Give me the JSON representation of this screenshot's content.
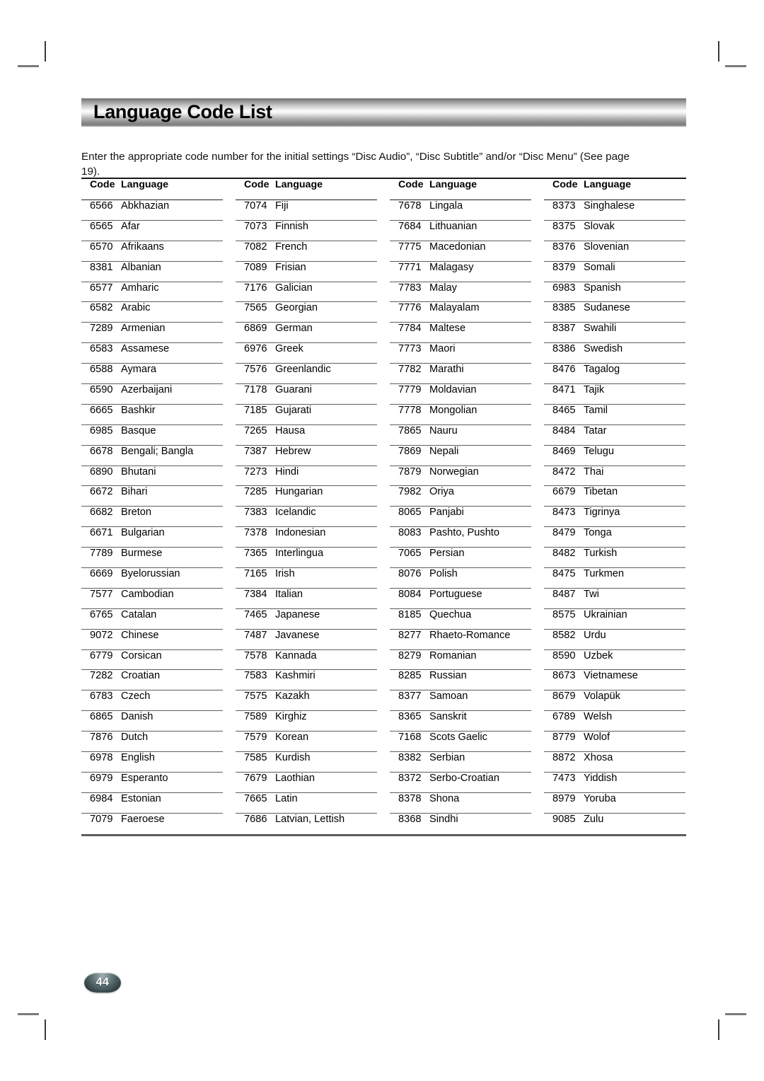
{
  "header": {
    "title": "Language Code List"
  },
  "intro": {
    "text": "Enter the appropriate code number for the initial settings “Disc Audio”, “Disc Subtitle” and/or “Disc Menu” (See page 19)."
  },
  "table": {
    "headers": {
      "code": "Code",
      "language": "Language"
    },
    "columns": [
      {
        "rows": [
          {
            "code": "6566",
            "language": "Abkhazian"
          },
          {
            "code": "6565",
            "language": "Afar"
          },
          {
            "code": "6570",
            "language": "Afrikaans"
          },
          {
            "code": "8381",
            "language": "Albanian"
          },
          {
            "code": "6577",
            "language": "Amharic"
          },
          {
            "code": "6582",
            "language": "Arabic"
          },
          {
            "code": "7289",
            "language": "Armenian"
          },
          {
            "code": "6583",
            "language": "Assamese"
          },
          {
            "code": "6588",
            "language": "Aymara"
          },
          {
            "code": "6590",
            "language": "Azerbaijani"
          },
          {
            "code": "6665",
            "language": "Bashkir"
          },
          {
            "code": "6985",
            "language": "Basque"
          },
          {
            "code": "6678",
            "language": "Bengali; Bangla"
          },
          {
            "code": "6890",
            "language": "Bhutani"
          },
          {
            "code": "6672",
            "language": "Bihari"
          },
          {
            "code": "6682",
            "language": "Breton"
          },
          {
            "code": "6671",
            "language": "Bulgarian"
          },
          {
            "code": "7789",
            "language": "Burmese"
          },
          {
            "code": "6669",
            "language": "Byelorussian"
          },
          {
            "code": "7577",
            "language": "Cambodian"
          },
          {
            "code": "6765",
            "language": "Catalan"
          },
          {
            "code": "9072",
            "language": "Chinese"
          },
          {
            "code": "6779",
            "language": "Corsican"
          },
          {
            "code": "7282",
            "language": "Croatian"
          },
          {
            "code": "6783",
            "language": "Czech"
          },
          {
            "code": "6865",
            "language": "Danish"
          },
          {
            "code": "7876",
            "language": "Dutch"
          },
          {
            "code": "6978",
            "language": "English"
          },
          {
            "code": "6979",
            "language": "Esperanto"
          },
          {
            "code": "6984",
            "language": "Estonian"
          },
          {
            "code": "7079",
            "language": "Faeroese"
          }
        ]
      },
      {
        "rows": [
          {
            "code": "7074",
            "language": "Fiji"
          },
          {
            "code": "7073",
            "language": "Finnish"
          },
          {
            "code": "7082",
            "language": "French"
          },
          {
            "code": "7089",
            "language": "Frisian"
          },
          {
            "code": "7176",
            "language": "Galician"
          },
          {
            "code": "7565",
            "language": "Georgian"
          },
          {
            "code": "6869",
            "language": "German"
          },
          {
            "code": "6976",
            "language": "Greek"
          },
          {
            "code": "7576",
            "language": "Greenlandic"
          },
          {
            "code": "7178",
            "language": "Guarani"
          },
          {
            "code": "7185",
            "language": "Gujarati"
          },
          {
            "code": "7265",
            "language": "Hausa"
          },
          {
            "code": "7387",
            "language": "Hebrew"
          },
          {
            "code": "7273",
            "language": "Hindi"
          },
          {
            "code": "7285",
            "language": "Hungarian"
          },
          {
            "code": "7383",
            "language": "Icelandic"
          },
          {
            "code": "7378",
            "language": "Indonesian"
          },
          {
            "code": "7365",
            "language": "Interlingua"
          },
          {
            "code": "7165",
            "language": "Irish"
          },
          {
            "code": "7384",
            "language": "Italian"
          },
          {
            "code": "7465",
            "language": "Japanese"
          },
          {
            "code": "7487",
            "language": "Javanese"
          },
          {
            "code": "7578",
            "language": "Kannada"
          },
          {
            "code": "7583",
            "language": "Kashmiri"
          },
          {
            "code": "7575",
            "language": "Kazakh"
          },
          {
            "code": "7589",
            "language": "Kirghiz"
          },
          {
            "code": "7579",
            "language": "Korean"
          },
          {
            "code": "7585",
            "language": "Kurdish"
          },
          {
            "code": "7679",
            "language": "Laothian"
          },
          {
            "code": "7665",
            "language": "Latin"
          },
          {
            "code": "7686",
            "language": "Latvian, Lettish"
          }
        ]
      },
      {
        "rows": [
          {
            "code": "7678",
            "language": "Lingala"
          },
          {
            "code": "7684",
            "language": "Lithuanian"
          },
          {
            "code": "7775",
            "language": "Macedonian"
          },
          {
            "code": "7771",
            "language": "Malagasy"
          },
          {
            "code": "7783",
            "language": "Malay"
          },
          {
            "code": "7776",
            "language": "Malayalam"
          },
          {
            "code": "7784",
            "language": "Maltese"
          },
          {
            "code": "7773",
            "language": "Maori"
          },
          {
            "code": "7782",
            "language": "Marathi"
          },
          {
            "code": "7779",
            "language": "Moldavian"
          },
          {
            "code": "7778",
            "language": "Mongolian"
          },
          {
            "code": "7865",
            "language": "Nauru"
          },
          {
            "code": "7869",
            "language": "Nepali"
          },
          {
            "code": "7879",
            "language": "Norwegian"
          },
          {
            "code": "7982",
            "language": "Oriya"
          },
          {
            "code": "8065",
            "language": "Panjabi"
          },
          {
            "code": "8083",
            "language": "Pashto, Pushto"
          },
          {
            "code": "7065",
            "language": "Persian"
          },
          {
            "code": "8076",
            "language": "Polish"
          },
          {
            "code": "8084",
            "language": "Portuguese"
          },
          {
            "code": "8185",
            "language": "Quechua"
          },
          {
            "code": "8277",
            "language": "Rhaeto-Romance"
          },
          {
            "code": "8279",
            "language": "Romanian"
          },
          {
            "code": "8285",
            "language": "Russian"
          },
          {
            "code": "8377",
            "language": "Samoan"
          },
          {
            "code": "8365",
            "language": "Sanskrit"
          },
          {
            "code": "7168",
            "language": "Scots Gaelic"
          },
          {
            "code": "8382",
            "language": "Serbian"
          },
          {
            "code": "8372",
            "language": "Serbo-Croatian"
          },
          {
            "code": "8378",
            "language": "Shona"
          },
          {
            "code": "8368",
            "language": "Sindhi"
          }
        ]
      },
      {
        "rows": [
          {
            "code": "8373",
            "language": "Singhalese"
          },
          {
            "code": "8375",
            "language": "Slovak"
          },
          {
            "code": "8376",
            "language": "Slovenian"
          },
          {
            "code": "8379",
            "language": "Somali"
          },
          {
            "code": "6983",
            "language": "Spanish"
          },
          {
            "code": "8385",
            "language": "Sudanese"
          },
          {
            "code": "8387",
            "language": "Swahili"
          },
          {
            "code": "8386",
            "language": "Swedish"
          },
          {
            "code": "8476",
            "language": "Tagalog"
          },
          {
            "code": "8471",
            "language": "Tajik"
          },
          {
            "code": "8465",
            "language": "Tamil"
          },
          {
            "code": "8484",
            "language": "Tatar"
          },
          {
            "code": "8469",
            "language": "Telugu"
          },
          {
            "code": "8472",
            "language": "Thai"
          },
          {
            "code": "6679",
            "language": "Tibetan"
          },
          {
            "code": "8473",
            "language": "Tigrinya"
          },
          {
            "code": "8479",
            "language": "Tonga"
          },
          {
            "code": "8482",
            "language": "Turkish"
          },
          {
            "code": "8475",
            "language": "Turkmen"
          },
          {
            "code": "8487",
            "language": "Twi"
          },
          {
            "code": "8575",
            "language": "Ukrainian"
          },
          {
            "code": "8582",
            "language": "Urdu"
          },
          {
            "code": "8590",
            "language": "Uzbek"
          },
          {
            "code": "8673",
            "language": "Vietnamese"
          },
          {
            "code": "8679",
            "language": "Volapük"
          },
          {
            "code": "6789",
            "language": "Welsh"
          },
          {
            "code": "8779",
            "language": "Wolof"
          },
          {
            "code": "8872",
            "language": "Xhosa"
          },
          {
            "code": "7473",
            "language": "Yiddish"
          },
          {
            "code": "8979",
            "language": "Yoruba"
          },
          {
            "code": "9085",
            "language": "Zulu"
          }
        ]
      }
    ]
  },
  "footer": {
    "page_number": "44"
  }
}
